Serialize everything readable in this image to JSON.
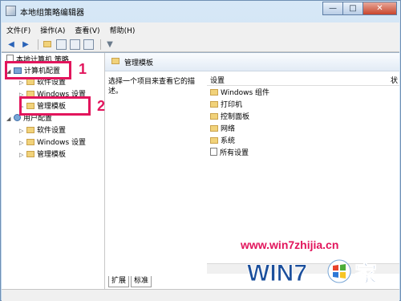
{
  "window": {
    "title": "本地组策略编辑器",
    "controls": {
      "minimize": "—",
      "maximize": "□",
      "close": "✕"
    }
  },
  "menubar": {
    "items": [
      "文件(F)",
      "操作(A)",
      "查看(V)",
      "帮助(H)"
    ]
  },
  "toolbar": {
    "icons": [
      "back-arrow-icon",
      "forward-arrow-icon",
      "folder-up-icon",
      "show-hide-tree-icon",
      "properties-icon",
      "help-icon",
      "filter-icon"
    ]
  },
  "tree": {
    "root": "本地计算机 策略",
    "computer_config": "计算机配置",
    "software_settings_1": "软件设置",
    "windows_settings_1": "Windows 设置",
    "admin_templates_1": "管理模板",
    "user_config": "用户配置",
    "software_settings_2": "软件设置",
    "windows_settings_2": "Windows 设置",
    "admin_templates_2": "管理模板"
  },
  "annotations": {
    "step1": "1",
    "step2": "2",
    "color": "#e2155c"
  },
  "right_pane": {
    "header_title": "管理模板",
    "description": "选择一个项目来查看它的描述。",
    "columns": {
      "setting": "设置",
      "status": "状"
    },
    "items": [
      "Windows 组件",
      "打印机",
      "控制面板",
      "网络",
      "系统",
      "所有设置"
    ]
  },
  "tabs": {
    "extended": "扩展",
    "standard": "标准"
  },
  "watermark": {
    "url": "www.win7zhijia.cn",
    "logo_text": "WIN7",
    "logo_suffix": "家"
  }
}
